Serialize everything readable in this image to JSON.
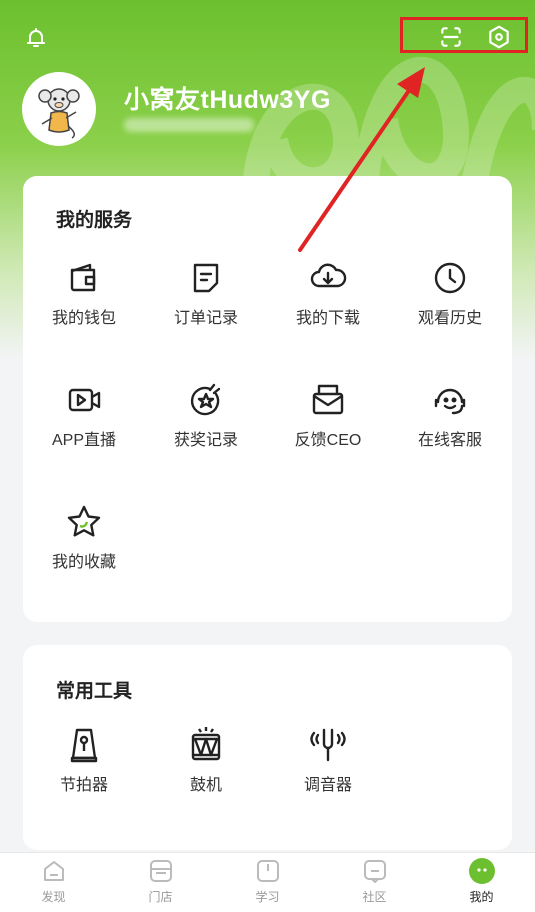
{
  "header": {
    "username": "小窝友tHudw3YG",
    "icons": [
      "bell-icon",
      "scan-icon",
      "settings-icon"
    ]
  },
  "services": {
    "title": "我的服务",
    "items": [
      {
        "label": "我的钱包",
        "icon": "wallet-icon"
      },
      {
        "label": "订单记录",
        "icon": "order-icon"
      },
      {
        "label": "我的下载",
        "icon": "cloud-download-icon"
      },
      {
        "label": "观看历史",
        "icon": "clock-icon"
      },
      {
        "label": "APP直播",
        "icon": "video-icon"
      },
      {
        "label": "获奖记录",
        "icon": "award-icon"
      },
      {
        "label": "反馈CEO",
        "icon": "mail-icon"
      },
      {
        "label": "在线客服",
        "icon": "headset-icon"
      },
      {
        "label": "我的收藏",
        "icon": "star-icon"
      }
    ]
  },
  "tools": {
    "title": "常用工具",
    "items": [
      {
        "label": "节拍器",
        "icon": "metronome-icon"
      },
      {
        "label": "鼓机",
        "icon": "drum-icon"
      },
      {
        "label": "调音器",
        "icon": "tuning-fork-icon"
      }
    ]
  },
  "tabbar": {
    "items": [
      {
        "label": "发现",
        "icon": "discover-icon"
      },
      {
        "label": "门店",
        "icon": "store-icon"
      },
      {
        "label": "学习",
        "icon": "book-icon"
      },
      {
        "label": "社区",
        "icon": "community-icon"
      },
      {
        "label": "我的",
        "icon": "profile-icon"
      }
    ],
    "active": "我的"
  },
  "colors": {
    "brand_green": "#6cc02f",
    "annotation_red": "#e02424"
  }
}
